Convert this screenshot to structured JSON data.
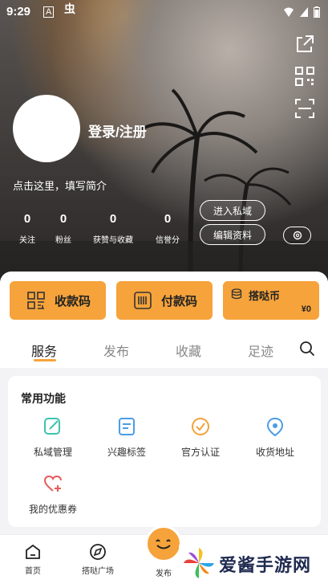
{
  "status_bar": {
    "time": "9:29",
    "icon_a": "A",
    "icon_b": "虫"
  },
  "profile": {
    "login_label": "登录/注册",
    "intro": "点击这里，填写简介",
    "stats": [
      {
        "value": "0",
        "label": "关注"
      },
      {
        "value": "0",
        "label": "粉丝"
      },
      {
        "value": "0",
        "label": "获赞与收藏"
      },
      {
        "value": "0",
        "label": "信誉分"
      }
    ],
    "enter_private_label": "进入私域",
    "edit_profile_label": "编辑资料"
  },
  "payments": {
    "collect_label": "收款码",
    "pay_label": "付款码",
    "coin_label": "搭哒币",
    "coin_value": "¥0"
  },
  "tabs": [
    {
      "label": "服务",
      "active": true
    },
    {
      "label": "发布",
      "active": false
    },
    {
      "label": "收藏",
      "active": false
    },
    {
      "label": "足迹",
      "active": false
    }
  ],
  "common": {
    "title": "常用功能",
    "items": [
      {
        "label": "私域管理",
        "icon": "edit-square-icon"
      },
      {
        "label": "兴趣标签",
        "icon": "tag-doc-icon"
      },
      {
        "label": "官方认证",
        "icon": "verified-badge-icon"
      },
      {
        "label": "收货地址",
        "icon": "location-pin-icon"
      },
      {
        "label": "我的优惠券",
        "icon": "heart-plus-icon"
      }
    ]
  },
  "bottom_nav": {
    "home": "首页",
    "square": "搭哒广场",
    "publish": "发布"
  },
  "watermark": {
    "text": "爱酱手游网"
  },
  "colors": {
    "accent": "#f6a33b",
    "teal": "#3cc3b0",
    "blue": "#4a9de8",
    "orange": "#f2a23a",
    "red": "#e85a5a"
  }
}
